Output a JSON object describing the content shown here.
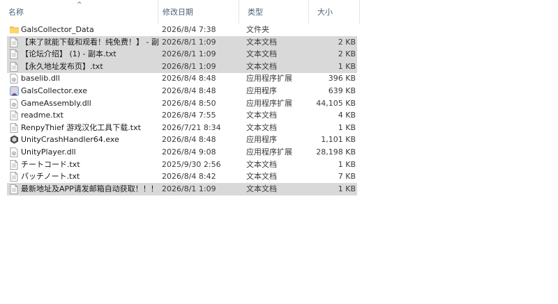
{
  "columns": {
    "name": "名称",
    "date": "修改日期",
    "type": "类型",
    "size": "大小"
  },
  "files": [
    {
      "name": "GalsCollector_Data",
      "date": "2026/8/4 7:38",
      "type": "文件夹",
      "size": "",
      "icon": "folder-icon",
      "selected": false
    },
    {
      "name": "【来了就能下载和观看！纯免费！】 - 副...",
      "date": "2026/8/1 1:09",
      "type": "文本文档",
      "size": "2 KB",
      "icon": "text-file-icon",
      "selected": true
    },
    {
      "name": "【论坛介绍】 (1) - 副本.txt",
      "date": "2026/8/1 1:09",
      "type": "文本文档",
      "size": "2 KB",
      "icon": "text-file-icon",
      "selected": true
    },
    {
      "name": "【永久地址发布页】.txt",
      "date": "2026/8/1 1:09",
      "type": "文本文档",
      "size": "1 KB",
      "icon": "text-file-icon",
      "selected": true
    },
    {
      "name": "baselib.dll",
      "date": "2026/8/4 8:48",
      "type": "应用程序扩展",
      "size": "396 KB",
      "icon": "dll-icon",
      "selected": false
    },
    {
      "name": "GalsCollector.exe",
      "date": "2026/8/4 8:48",
      "type": "应用程序",
      "size": "639 KB",
      "icon": "app-icon",
      "selected": false
    },
    {
      "name": "GameAssembly.dll",
      "date": "2026/8/4 8:50",
      "type": "应用程序扩展",
      "size": "44,105 KB",
      "icon": "dll-icon",
      "selected": false
    },
    {
      "name": "readme.txt",
      "date": "2026/8/4 7:55",
      "type": "文本文档",
      "size": "4 KB",
      "icon": "text-file-icon",
      "selected": false
    },
    {
      "name": "RenpyThief 游戏汉化工具下载.txt",
      "date": "2026/7/21 8:34",
      "type": "文本文档",
      "size": "1 KB",
      "icon": "text-file-icon",
      "selected": false
    },
    {
      "name": "UnityCrashHandler64.exe",
      "date": "2026/8/4 8:48",
      "type": "应用程序",
      "size": "1,101 KB",
      "icon": "unity-icon",
      "selected": false
    },
    {
      "name": "UnityPlayer.dll",
      "date": "2026/8/4 9:08",
      "type": "应用程序扩展",
      "size": "28,198 KB",
      "icon": "dll-icon",
      "selected": false
    },
    {
      "name": "チートコード.txt",
      "date": "2025/9/30 2:56",
      "type": "文本文档",
      "size": "1 KB",
      "icon": "text-file-icon",
      "selected": false
    },
    {
      "name": "パッチノート.txt",
      "date": "2026/8/4 8:42",
      "type": "文本文档",
      "size": "7 KB",
      "icon": "text-file-icon",
      "selected": false
    },
    {
      "name": "最新地址及APP请发邮箱自动获取！！！...",
      "date": "2026/8/1 1:09",
      "type": "文本文档",
      "size": "1 KB",
      "icon": "text-file-icon",
      "selected": true
    }
  ]
}
